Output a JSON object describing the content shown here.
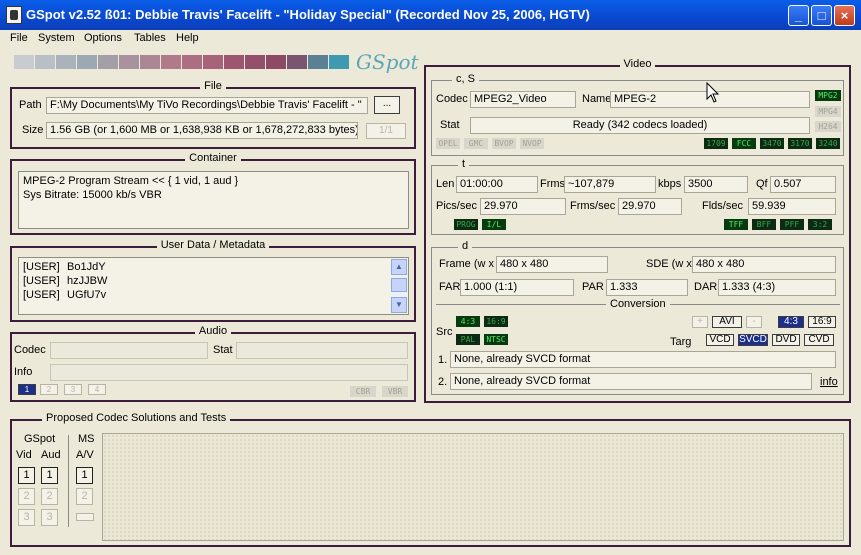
{
  "window": {
    "title": "GSpot v2.52 ß01: Debbie Travis' Facelift - \"Holiday Special\" (Recorded Nov 25, 2006, HGTV)",
    "min": "_",
    "max": "□",
    "close": "×"
  },
  "menu": [
    "File",
    "System",
    "Options",
    "Tables",
    "Help"
  ],
  "logo": "GSpot",
  "gradient_colors": [
    "#c8ccd0",
    "#b8bfc6",
    "#aab3bc",
    "#9ca8b2",
    "#a39ea8",
    "#a7929e",
    "#ab8694",
    "#b07a8b",
    "#ac6e82",
    "#a86279",
    "#9c5670",
    "#94506a",
    "#8c4a64",
    "#7a5570",
    "#5b7f94",
    "#3d9ab0"
  ],
  "file": {
    "title": "File",
    "path_label": "Path",
    "path_value": "F:\\My Documents\\My TiVo Recordings\\Debbie Travis' Facelift - \"",
    "browse": "...",
    "size_label": "Size",
    "size_value": "1.56 GB (or 1,600 MB or 1,638,938 KB or 1,678,272,833 bytes)",
    "page": "1/1"
  },
  "container": {
    "title": "Container",
    "line1": "MPEG-2 Program Stream << { 1 vid, 1 aud }",
    "line2": "Sys Bitrate: 15000 kb/s VBR"
  },
  "userdata": {
    "title": "User Data / Metadata",
    "rows": [
      [
        "[USER]",
        "Bo1JdY"
      ],
      [
        "[USER]",
        "hzJJBW"
      ],
      [
        "[USER]",
        "UGfU7v"
      ]
    ]
  },
  "audio": {
    "title": "Audio",
    "codec_label": "Codec",
    "stat_label": "Stat",
    "info_label": "Info",
    "tracks": [
      "1",
      "2",
      "3",
      "4"
    ],
    "cbr": "CBR",
    "vbr": "VBR"
  },
  "video": {
    "title": "Video",
    "cs": {
      "title": "c, S",
      "codec_label": "Codec",
      "codec_value": "MPEG2_Video",
      "name_label": "Name",
      "name_value": "MPEG-2",
      "stat_label": "Stat",
      "stat_value": "Ready (342 codecs loaded)",
      "side_leds": [
        "MPG2",
        "MPG4",
        "H264"
      ],
      "flags": [
        "OPEL",
        "GMC",
        "BVOP",
        "NVOP"
      ],
      "leds": [
        "1709",
        "FCC",
        "3470",
        "3170",
        "3240"
      ]
    },
    "t": {
      "title": "t",
      "len_label": "Len",
      "len_value": "01:00:00",
      "frms_label": "Frms",
      "frms_value": "~107,879",
      "kbps_label": "kbps",
      "kbps_value": "3500",
      "qf_label": "Qf",
      "qf_value": "0.507",
      "pics_label": "Pics/sec",
      "pics_value": "29.970",
      "frmssec_label": "Frms/sec",
      "frmssec_value": "29.970",
      "flds_label": "Flds/sec",
      "flds_value": "59.939",
      "left_leds": [
        "PROG",
        "I/L"
      ],
      "right_leds": [
        "TFF",
        "BFF",
        "PFF",
        "3:2"
      ]
    },
    "d": {
      "title": "d",
      "frame_label": "Frame (w x",
      "frame_value": "480 x 480",
      "sde_label": "SDE (w x",
      "sde_value": "480 x 480",
      "far_label": "FAR",
      "far_value": "1.000 (1:1)",
      "par_label": "PAR",
      "par_value": "1.333",
      "dar_label": "DAR",
      "dar_value": "1.333 (4:3)",
      "conversion_title": "Conversion",
      "src_label": "Src",
      "src_leds": [
        "4:3",
        "16:9",
        "PAL",
        "NTSC"
      ],
      "targ_label": "Targ",
      "plus": "+",
      "avi": "AVI",
      "minus": "-",
      "aspect_btns": [
        "4:3",
        "16:9"
      ],
      "targ_btns": [
        "VCD",
        "SVCD",
        "DVD",
        "CVD"
      ],
      "conv1_num": "1.",
      "conv1": "None, already SVCD format",
      "conv2_num": "2.",
      "conv2": "None, already SVCD format",
      "info_link": "info"
    }
  },
  "codec_solutions": {
    "title": "Proposed Codec Solutions and Tests",
    "gspot_label": "GSpot",
    "vid_label": "Vid",
    "aud_label": "Aud",
    "ms_label": "MS",
    "av_label": "A/V",
    "nums": [
      "1",
      "2",
      "3"
    ]
  },
  "colors": {
    "title_bar": "#0a4fd8",
    "group_border": "#3d1e3a",
    "window_bg": "#ece9d8",
    "led_on": "#58e868"
  }
}
